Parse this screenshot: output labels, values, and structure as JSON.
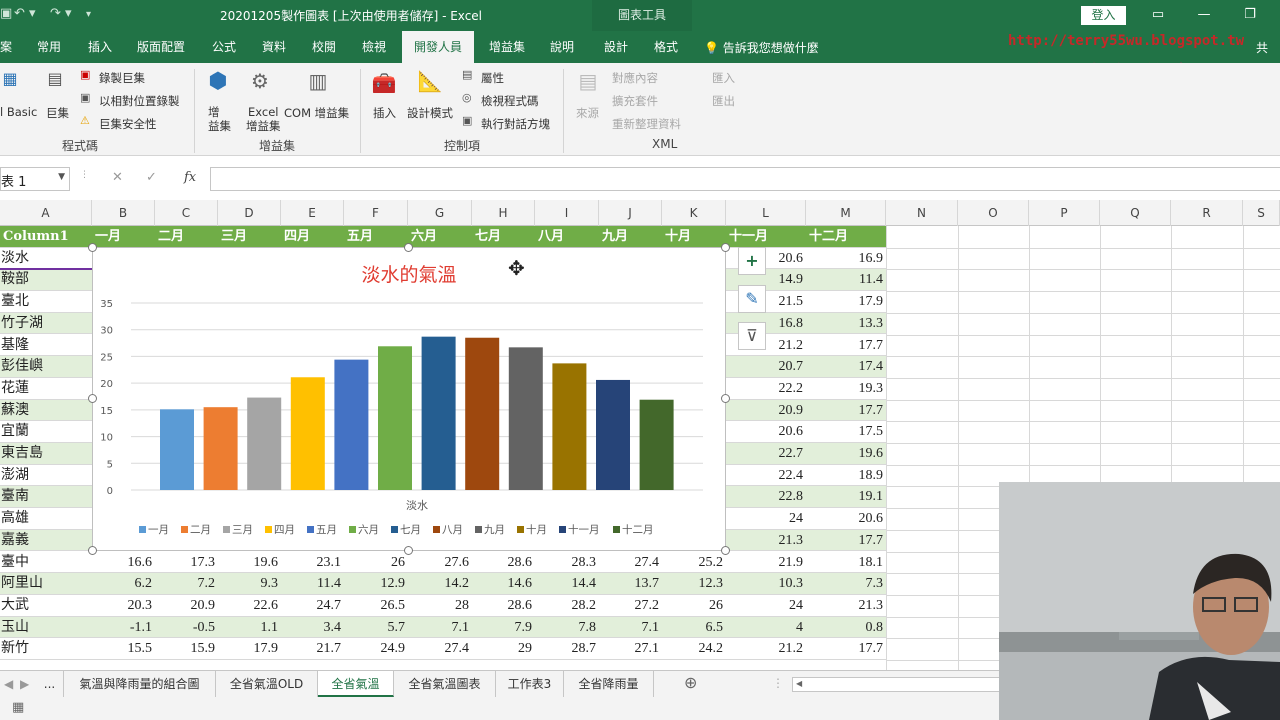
{
  "window": {
    "title": "20201205製作圖表 [上次由使用者儲存] - Excel",
    "context_tab": "圖表工具",
    "signin": "登入"
  },
  "tabs": [
    "常用",
    "插入",
    "版面配置",
    "公式",
    "資料",
    "校閱",
    "檢視",
    "開發人員",
    "增益集",
    "說明",
    "設計",
    "格式"
  ],
  "active_tab": "開發人員",
  "tellme": "告訴我您想做什麼",
  "share": "共",
  "watermark": {
    "url": "http://terry55wu.blogspot.tw",
    "name": "吳清輝老師錄製"
  },
  "ribbon": {
    "code": {
      "vb": "l Basic",
      "macros": "巨集",
      "record": "錄製巨集",
      "relative": "以相對位置錄製",
      "security": "巨集安全性",
      "group": "程式碼"
    },
    "addins": {
      "addins": "增\n益集",
      "excel_addins": "Excel\n增益集",
      "com": "COM 增益集",
      "group": "增益集"
    },
    "controls": {
      "insert": "插入",
      "design": "設計模式",
      "properties": "屬性",
      "view_code": "檢視程式碼",
      "dialog": "執行對話方塊",
      "group": "控制項"
    },
    "xml": {
      "source": "來源",
      "map_props": "對應內容",
      "expansion": "擴充套件",
      "refresh": "重新整理資料",
      "import": "匯入",
      "export": "匯出",
      "group": "XML"
    }
  },
  "namebox": "表 1",
  "fx": "fx",
  "columns": [
    "A",
    "B",
    "C",
    "D",
    "E",
    "F",
    "G",
    "H",
    "I",
    "J",
    "K",
    "L",
    "M",
    "N",
    "O",
    "P",
    "Q",
    "R",
    "S"
  ],
  "table": {
    "header": [
      "Column1",
      "一月",
      "二月",
      "三月",
      "四月",
      "五月",
      "六月",
      "七月",
      "八月",
      "九月",
      "十月",
      "十一月",
      "十二月"
    ],
    "rows": [
      {
        "name": "淡水",
        "L": "20.6",
        "M": "16.9"
      },
      {
        "name": "鞍部",
        "L": "14.9",
        "M": "11.4"
      },
      {
        "name": "臺北",
        "L": "21.5",
        "M": "17.9"
      },
      {
        "name": "竹子湖",
        "L": "16.8",
        "M": "13.3"
      },
      {
        "name": "基隆",
        "L": "21.2",
        "M": "17.7"
      },
      {
        "name": "彭佳嶼",
        "L": "20.7",
        "M": "17.4"
      },
      {
        "name": "花蓮",
        "L": "22.2",
        "M": "19.3"
      },
      {
        "name": "蘇澳",
        "L": "20.9",
        "M": "17.7"
      },
      {
        "name": "宜蘭",
        "L": "20.6",
        "M": "17.5"
      },
      {
        "name": "東吉島",
        "L": "22.7",
        "M": "19.6"
      },
      {
        "name": "澎湖",
        "L": "22.4",
        "M": "18.9"
      },
      {
        "name": "臺南",
        "L": "22.8",
        "M": "19.1"
      },
      {
        "name": "高雄",
        "L": "24",
        "M": "20.6"
      },
      {
        "name": "嘉義",
        "L": "21.3",
        "M": "17.7"
      },
      {
        "name": "臺中",
        "vals": [
          "16.6",
          "17.3",
          "19.6",
          "23.1",
          "26",
          "27.6",
          "28.6",
          "28.3",
          "27.4",
          "25.2",
          "21.9",
          "18.1"
        ]
      },
      {
        "name": "阿里山",
        "vals": [
          "6.2",
          "7.2",
          "9.3",
          "11.4",
          "12.9",
          "14.2",
          "14.6",
          "14.4",
          "13.7",
          "12.3",
          "10.3",
          "7.3"
        ]
      },
      {
        "name": "大武",
        "vals": [
          "20.3",
          "20.9",
          "22.6",
          "24.7",
          "26.5",
          "28",
          "28.6",
          "28.2",
          "27.2",
          "26",
          "24",
          "21.3"
        ]
      },
      {
        "name": "玉山",
        "vals": [
          "-1.1",
          "-0.5",
          "1.1",
          "3.4",
          "5.7",
          "7.1",
          "7.9",
          "7.8",
          "7.1",
          "6.5",
          "4",
          "0.8"
        ]
      },
      {
        "name": "新竹",
        "vals": [
          "15.5",
          "15.9",
          "17.9",
          "21.7",
          "24.9",
          "27.4",
          "29",
          "28.7",
          "27.1",
          "24.2",
          "21.2",
          "17.7"
        ]
      }
    ]
  },
  "chart_data": {
    "type": "bar",
    "title": "淡水的氣溫",
    "categories": [
      "淡水"
    ],
    "xlabel": "淡水",
    "ylim": [
      0,
      35
    ],
    "yticks": [
      0,
      5,
      10,
      15,
      20,
      25,
      30,
      35
    ],
    "grid": true,
    "legend": "bottom",
    "series": [
      {
        "name": "一月",
        "values": [
          15.1
        ],
        "color": "#5b9bd5"
      },
      {
        "name": "二月",
        "values": [
          15.5
        ],
        "color": "#ed7d31"
      },
      {
        "name": "三月",
        "values": [
          17.3
        ],
        "color": "#a5a5a5"
      },
      {
        "name": "四月",
        "values": [
          21.1
        ],
        "color": "#ffc000"
      },
      {
        "name": "五月",
        "values": [
          24.4
        ],
        "color": "#4472c4"
      },
      {
        "name": "六月",
        "values": [
          26.9
        ],
        "color": "#70ad47"
      },
      {
        "name": "七月",
        "values": [
          28.7
        ],
        "color": "#255e91"
      },
      {
        "name": "八月",
        "values": [
          28.5
        ],
        "color": "#9e480e"
      },
      {
        "name": "九月",
        "values": [
          26.7
        ],
        "color": "#636363"
      },
      {
        "name": "十月",
        "values": [
          23.7
        ],
        "color": "#997300"
      },
      {
        "name": "十一月",
        "values": [
          20.6
        ],
        "color": "#264478"
      },
      {
        "name": "十二月",
        "values": [
          16.9
        ],
        "color": "#43682b"
      }
    ]
  },
  "sheets": [
    "...",
    "氣溫與降雨量的組合圖",
    "全省氣溫OLD",
    "全省氣溫",
    "全省氣溫圖表",
    "工作表3",
    "全省降雨量"
  ],
  "active_sheet": "全省氣溫"
}
